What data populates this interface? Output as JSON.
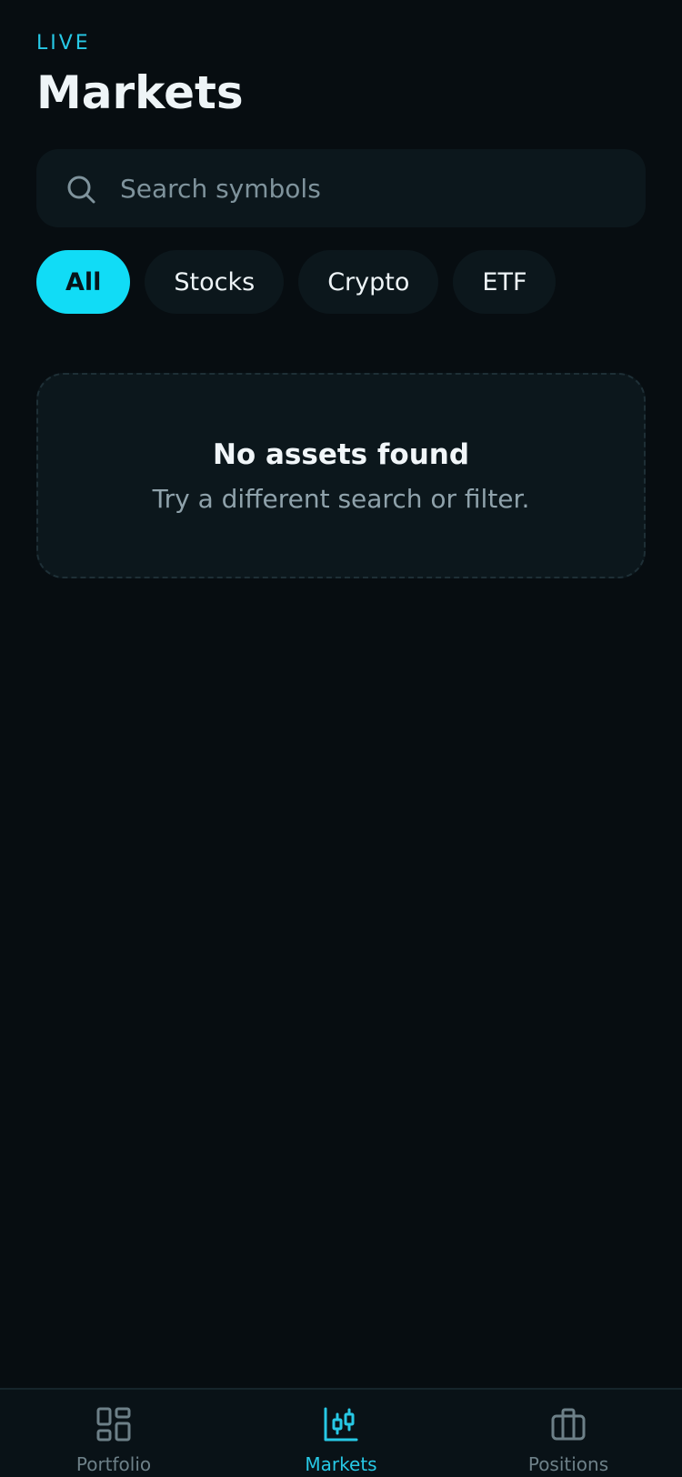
{
  "header": {
    "eyebrow": "LIVE",
    "title": "Markets"
  },
  "search": {
    "placeholder": "Search symbols",
    "value": ""
  },
  "filters": [
    {
      "label": "All",
      "active": true
    },
    {
      "label": "Stocks",
      "active": false
    },
    {
      "label": "Crypto",
      "active": false
    },
    {
      "label": "ETF",
      "active": false
    }
  ],
  "empty_state": {
    "title": "No assets found",
    "message": "Try a different search or filter."
  },
  "tabbar": [
    {
      "label": "Portfolio",
      "icon": "grid-icon",
      "active": false
    },
    {
      "label": "Markets",
      "icon": "candlestick-chart-icon",
      "active": true
    },
    {
      "label": "Positions",
      "icon": "briefcase-icon",
      "active": false
    }
  ],
  "colors": {
    "background": "#070d11",
    "surface": "#0c171c",
    "accent": "#11dcf6",
    "accent_text": "#27c9e6",
    "muted_text": "#8fa2ab"
  }
}
